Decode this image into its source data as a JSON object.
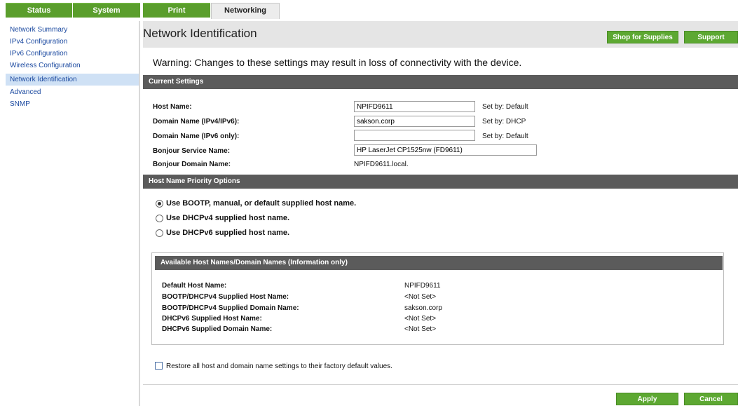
{
  "top_tabs": [
    "Status",
    "System",
    "Print",
    "Networking"
  ],
  "nav": {
    "items": [
      "Network Summary",
      "IPv4 Configuration",
      "IPv6 Configuration",
      "Wireless Configuration",
      "Network Identification",
      "Advanced",
      "SNMP"
    ],
    "active": "Network Identification"
  },
  "header": {
    "title": "Network Identification",
    "shop_button": "Shop for Supplies",
    "support_button": "Support"
  },
  "warning": "Warning: Changes to these settings may result in loss of connectivity with the device.",
  "current_settings": {
    "heading": "Current Settings",
    "host_name": {
      "label": "Host Name:",
      "value": "NPIFD9611",
      "set_by": "Set by:  Default"
    },
    "domain_ipv4": {
      "label": "Domain Name (IPv4/IPv6):",
      "value": "sakson.corp",
      "set_by": "Set by:  DHCP"
    },
    "domain_ipv6": {
      "label": "Domain Name (IPv6 only):",
      "value": "",
      "set_by": "Set by:  Default"
    },
    "bonjour_service": {
      "label": "Bonjour Service Name:",
      "value": "HP LaserJet CP1525nw (FD9611)"
    },
    "bonjour_domain": {
      "label": "Bonjour Domain Name:",
      "value": "NPIFD9611.local."
    }
  },
  "priority": {
    "heading": "Host Name Priority Options",
    "options": [
      "Use BOOTP, manual, or default supplied host name.",
      "Use DHCPv4 supplied host name.",
      "Use DHCPv6 supplied host name."
    ],
    "selected_index": 0
  },
  "available": {
    "heading": "Available Host Names/Domain Names (Information only)",
    "rows": [
      {
        "label": "Default Host Name:",
        "value": "NPIFD9611"
      },
      {
        "label": "BOOTP/DHCPv4 Supplied Host Name:",
        "value": "<Not Set>"
      },
      {
        "label": "BOOTP/DHCPv4 Supplied Domain Name:",
        "value": "sakson.corp"
      },
      {
        "label": "DHCPv6 Supplied Host Name:",
        "value": "<Not Set>"
      },
      {
        "label": "DHCPv6 Supplied Domain Name:",
        "value": "<Not Set>"
      }
    ]
  },
  "restore_label": "Restore all host and domain name settings to their factory default values.",
  "restore_checked": false,
  "buttons": {
    "apply": "Apply",
    "cancel": "Cancel"
  },
  "colors": {
    "brand_green": "#5da832",
    "section_bar": "#5b5b5b",
    "nav_active": "#cfe1f5",
    "link_blue": "#1c4aa0"
  }
}
